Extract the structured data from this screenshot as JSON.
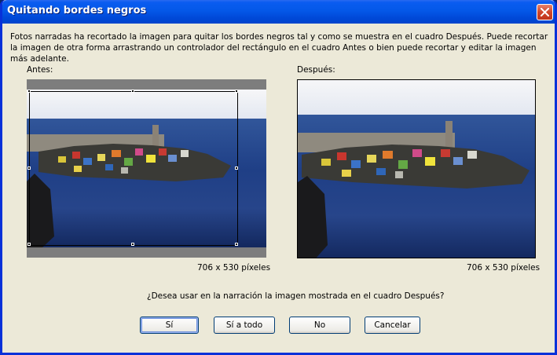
{
  "window": {
    "title": "Quitando bordes negros"
  },
  "description": "Fotos narradas ha recortado la imagen para quitar los bordes negros tal y como se muestra en el cuadro Después. Puede recortar la imagen de otra forma arrastrando un controlador del rectángulo en el cuadro Antes o bien puede recortar y editar la imagen más adelante.",
  "before": {
    "label": "Antes:",
    "size": "706 x 530 píxeles"
  },
  "after": {
    "label": "Después:",
    "size": "706 x 530 píxeles"
  },
  "question": "¿Desea usar en la narración la imagen mostrada en el cuadro Después?",
  "buttons": {
    "yes": "Sí",
    "yes_all": "Sí a todo",
    "no": "No",
    "cancel": "Cancelar"
  },
  "colors": {
    "title_bar": "#0458e8",
    "window_bg": "#ece9d8",
    "close_button": "#d0462b"
  },
  "icons": [
    "close-icon"
  ]
}
